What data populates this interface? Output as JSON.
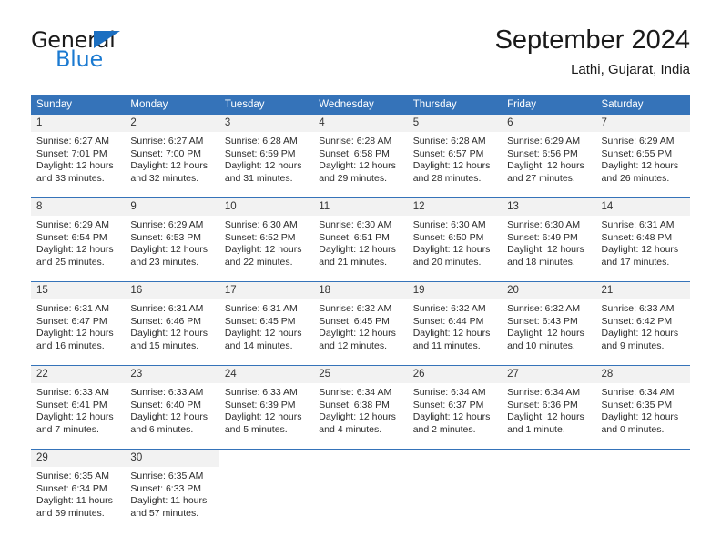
{
  "logo": {
    "word_top": "General",
    "word_bottom": "Blue",
    "triangle_color": "#1b6fc1",
    "blue_color": "#1b7ad1"
  },
  "header": {
    "month_title": "September 2024",
    "location": "Lathi, Gujarat, India"
  },
  "theme": {
    "header_blue": "#3573b9",
    "daynum_background": "#f2f2f2",
    "separator_blue": "#3573b9"
  },
  "calendar": {
    "day_headers": [
      "Sunday",
      "Monday",
      "Tuesday",
      "Wednesday",
      "Thursday",
      "Friday",
      "Saturday"
    ],
    "weeks": [
      [
        {
          "day": "1",
          "sunrise": "Sunrise: 6:27 AM",
          "sunset": "Sunset: 7:01 PM",
          "daylight_1": "Daylight: 12 hours",
          "daylight_2": "and 33 minutes."
        },
        {
          "day": "2",
          "sunrise": "Sunrise: 6:27 AM",
          "sunset": "Sunset: 7:00 PM",
          "daylight_1": "Daylight: 12 hours",
          "daylight_2": "and 32 minutes."
        },
        {
          "day": "3",
          "sunrise": "Sunrise: 6:28 AM",
          "sunset": "Sunset: 6:59 PM",
          "daylight_1": "Daylight: 12 hours",
          "daylight_2": "and 31 minutes."
        },
        {
          "day": "4",
          "sunrise": "Sunrise: 6:28 AM",
          "sunset": "Sunset: 6:58 PM",
          "daylight_1": "Daylight: 12 hours",
          "daylight_2": "and 29 minutes."
        },
        {
          "day": "5",
          "sunrise": "Sunrise: 6:28 AM",
          "sunset": "Sunset: 6:57 PM",
          "daylight_1": "Daylight: 12 hours",
          "daylight_2": "and 28 minutes."
        },
        {
          "day": "6",
          "sunrise": "Sunrise: 6:29 AM",
          "sunset": "Sunset: 6:56 PM",
          "daylight_1": "Daylight: 12 hours",
          "daylight_2": "and 27 minutes."
        },
        {
          "day": "7",
          "sunrise": "Sunrise: 6:29 AM",
          "sunset": "Sunset: 6:55 PM",
          "daylight_1": "Daylight: 12 hours",
          "daylight_2": "and 26 minutes."
        }
      ],
      [
        {
          "day": "8",
          "sunrise": "Sunrise: 6:29 AM",
          "sunset": "Sunset: 6:54 PM",
          "daylight_1": "Daylight: 12 hours",
          "daylight_2": "and 25 minutes."
        },
        {
          "day": "9",
          "sunrise": "Sunrise: 6:29 AM",
          "sunset": "Sunset: 6:53 PM",
          "daylight_1": "Daylight: 12 hours",
          "daylight_2": "and 23 minutes."
        },
        {
          "day": "10",
          "sunrise": "Sunrise: 6:30 AM",
          "sunset": "Sunset: 6:52 PM",
          "daylight_1": "Daylight: 12 hours",
          "daylight_2": "and 22 minutes."
        },
        {
          "day": "11",
          "sunrise": "Sunrise: 6:30 AM",
          "sunset": "Sunset: 6:51 PM",
          "daylight_1": "Daylight: 12 hours",
          "daylight_2": "and 21 minutes."
        },
        {
          "day": "12",
          "sunrise": "Sunrise: 6:30 AM",
          "sunset": "Sunset: 6:50 PM",
          "daylight_1": "Daylight: 12 hours",
          "daylight_2": "and 20 minutes."
        },
        {
          "day": "13",
          "sunrise": "Sunrise: 6:30 AM",
          "sunset": "Sunset: 6:49 PM",
          "daylight_1": "Daylight: 12 hours",
          "daylight_2": "and 18 minutes."
        },
        {
          "day": "14",
          "sunrise": "Sunrise: 6:31 AM",
          "sunset": "Sunset: 6:48 PM",
          "daylight_1": "Daylight: 12 hours",
          "daylight_2": "and 17 minutes."
        }
      ],
      [
        {
          "day": "15",
          "sunrise": "Sunrise: 6:31 AM",
          "sunset": "Sunset: 6:47 PM",
          "daylight_1": "Daylight: 12 hours",
          "daylight_2": "and 16 minutes."
        },
        {
          "day": "16",
          "sunrise": "Sunrise: 6:31 AM",
          "sunset": "Sunset: 6:46 PM",
          "daylight_1": "Daylight: 12 hours",
          "daylight_2": "and 15 minutes."
        },
        {
          "day": "17",
          "sunrise": "Sunrise: 6:31 AM",
          "sunset": "Sunset: 6:45 PM",
          "daylight_1": "Daylight: 12 hours",
          "daylight_2": "and 14 minutes."
        },
        {
          "day": "18",
          "sunrise": "Sunrise: 6:32 AM",
          "sunset": "Sunset: 6:45 PM",
          "daylight_1": "Daylight: 12 hours",
          "daylight_2": "and 12 minutes."
        },
        {
          "day": "19",
          "sunrise": "Sunrise: 6:32 AM",
          "sunset": "Sunset: 6:44 PM",
          "daylight_1": "Daylight: 12 hours",
          "daylight_2": "and 11 minutes."
        },
        {
          "day": "20",
          "sunrise": "Sunrise: 6:32 AM",
          "sunset": "Sunset: 6:43 PM",
          "daylight_1": "Daylight: 12 hours",
          "daylight_2": "and 10 minutes."
        },
        {
          "day": "21",
          "sunrise": "Sunrise: 6:33 AM",
          "sunset": "Sunset: 6:42 PM",
          "daylight_1": "Daylight: 12 hours",
          "daylight_2": "and 9 minutes."
        }
      ],
      [
        {
          "day": "22",
          "sunrise": "Sunrise: 6:33 AM",
          "sunset": "Sunset: 6:41 PM",
          "daylight_1": "Daylight: 12 hours",
          "daylight_2": "and 7 minutes."
        },
        {
          "day": "23",
          "sunrise": "Sunrise: 6:33 AM",
          "sunset": "Sunset: 6:40 PM",
          "daylight_1": "Daylight: 12 hours",
          "daylight_2": "and 6 minutes."
        },
        {
          "day": "24",
          "sunrise": "Sunrise: 6:33 AM",
          "sunset": "Sunset: 6:39 PM",
          "daylight_1": "Daylight: 12 hours",
          "daylight_2": "and 5 minutes."
        },
        {
          "day": "25",
          "sunrise": "Sunrise: 6:34 AM",
          "sunset": "Sunset: 6:38 PM",
          "daylight_1": "Daylight: 12 hours",
          "daylight_2": "and 4 minutes."
        },
        {
          "day": "26",
          "sunrise": "Sunrise: 6:34 AM",
          "sunset": "Sunset: 6:37 PM",
          "daylight_1": "Daylight: 12 hours",
          "daylight_2": "and 2 minutes."
        },
        {
          "day": "27",
          "sunrise": "Sunrise: 6:34 AM",
          "sunset": "Sunset: 6:36 PM",
          "daylight_1": "Daylight: 12 hours",
          "daylight_2": "and 1 minute."
        },
        {
          "day": "28",
          "sunrise": "Sunrise: 6:34 AM",
          "sunset": "Sunset: 6:35 PM",
          "daylight_1": "Daylight: 12 hours",
          "daylight_2": "and 0 minutes."
        }
      ],
      [
        {
          "day": "29",
          "sunrise": "Sunrise: 6:35 AM",
          "sunset": "Sunset: 6:34 PM",
          "daylight_1": "Daylight: 11 hours",
          "daylight_2": "and 59 minutes."
        },
        {
          "day": "30",
          "sunrise": "Sunrise: 6:35 AM",
          "sunset": "Sunset: 6:33 PM",
          "daylight_1": "Daylight: 11 hours",
          "daylight_2": "and 57 minutes."
        },
        {
          "day": "",
          "sunrise": "",
          "sunset": "",
          "daylight_1": "",
          "daylight_2": ""
        },
        {
          "day": "",
          "sunrise": "",
          "sunset": "",
          "daylight_1": "",
          "daylight_2": ""
        },
        {
          "day": "",
          "sunrise": "",
          "sunset": "",
          "daylight_1": "",
          "daylight_2": ""
        },
        {
          "day": "",
          "sunrise": "",
          "sunset": "",
          "daylight_1": "",
          "daylight_2": ""
        },
        {
          "day": "",
          "sunrise": "",
          "sunset": "",
          "daylight_1": "",
          "daylight_2": ""
        }
      ]
    ]
  }
}
